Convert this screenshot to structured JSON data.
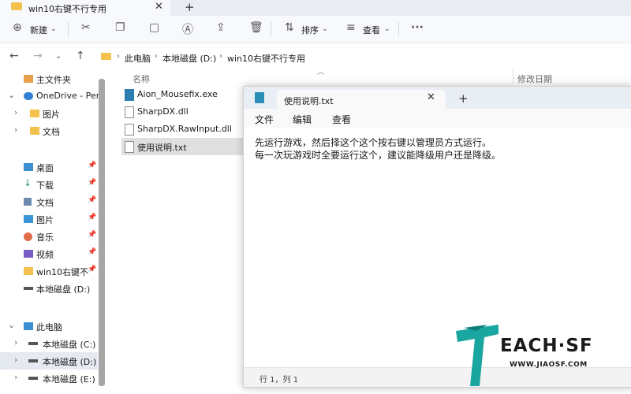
{
  "explorer": {
    "tab_title": "win10右键不行专用",
    "toolbar": {
      "new_label": "新建",
      "sort_label": "排序",
      "view_label": "查看"
    },
    "breadcrumbs": [
      "此电脑",
      "本地磁盘 (D:)",
      "win10右键不行专用"
    ],
    "sidebar": {
      "items": [
        {
          "label": "主文件夹",
          "icon": "home-icon"
        },
        {
          "label": "OneDrive - Per",
          "icon": "cloud-icon"
        },
        {
          "label": "图片",
          "icon": "folder-icon"
        },
        {
          "label": "文档",
          "icon": "folder-icon"
        },
        {
          "label": "桌面",
          "icon": "desktop-icon"
        },
        {
          "label": "下载",
          "icon": "download-icon"
        },
        {
          "label": "文档",
          "icon": "document-icon"
        },
        {
          "label": "图片",
          "icon": "picture-icon"
        },
        {
          "label": "音乐",
          "icon": "music-icon"
        },
        {
          "label": "视频",
          "icon": "video-icon"
        },
        {
          "label": "win10右键不",
          "icon": "folder-icon"
        },
        {
          "label": "本地磁盘 (D:)",
          "icon": "drive-icon"
        },
        {
          "label": "此电脑",
          "icon": "computer-icon"
        },
        {
          "label": "本地磁盘 (C:)",
          "icon": "drive-icon"
        },
        {
          "label": "本地磁盘 (D:)",
          "icon": "drive-icon"
        },
        {
          "label": "本地磁盘 (E:)",
          "icon": "drive-icon"
        }
      ]
    },
    "columns": {
      "name": "名称",
      "modified": "修改日期"
    },
    "files": [
      {
        "name": "Aion_Mousefix.exe",
        "icon": "exe-icon"
      },
      {
        "name": "SharpDX.dll",
        "icon": "dll-icon"
      },
      {
        "name": "SharpDX.RawInput.dll",
        "icon": "dll-icon"
      },
      {
        "name": "使用说明.txt",
        "icon": "txt-icon"
      }
    ]
  },
  "notepad": {
    "tab_title": "使用说明.txt",
    "menu": [
      "文件",
      "编辑",
      "查看"
    ],
    "lines": [
      "先运行游戏，然后择这个这个按右键以管理员方式运行。",
      "每一次玩游戏时全要运行这个，建议能降级用户还是降级。"
    ],
    "status": "行 1，列 1"
  },
  "watermark": {
    "logo_text": "EACH·SF",
    "url": "WWW.JIAOSF.COM"
  },
  "colors": {
    "accent_teal": "#1aa6a0",
    "folder_yellow": "#f2c14e",
    "selection": "#e5eaf1"
  }
}
